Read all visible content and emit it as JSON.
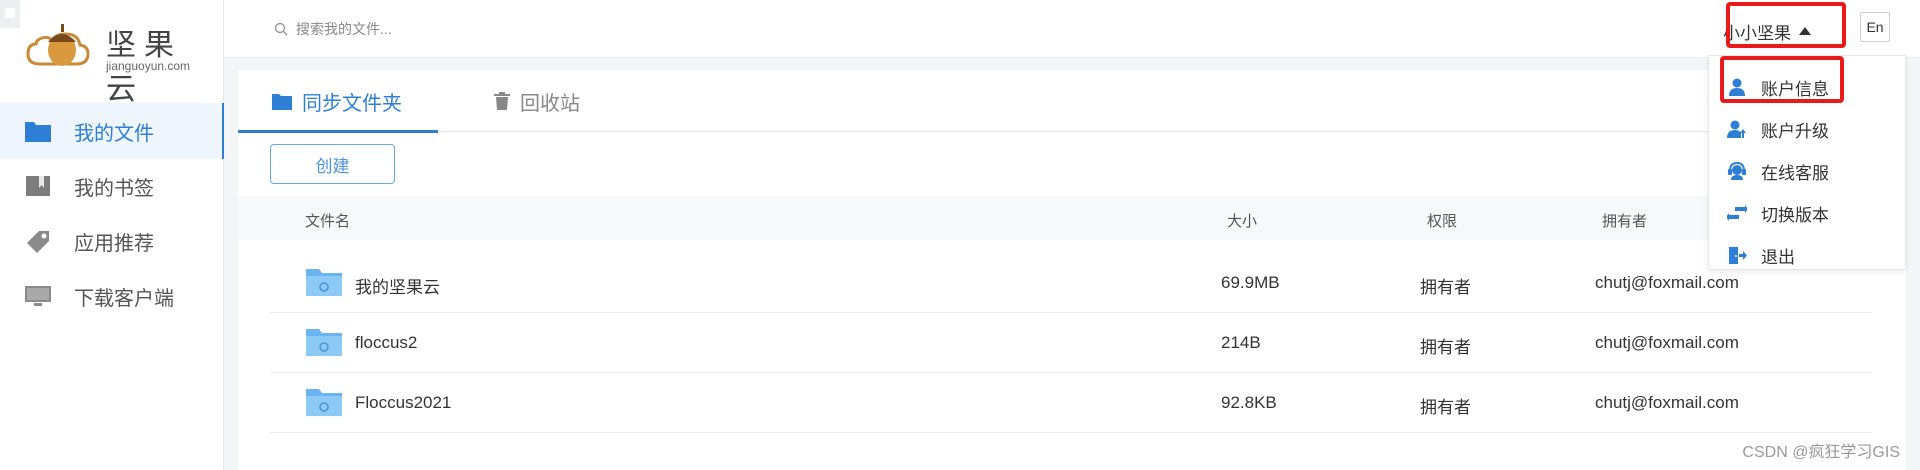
{
  "logo": {
    "text": "坚果云",
    "sub": "jianguoyun.com",
    "icon": "acorn-logo-icon"
  },
  "sidebar": {
    "items": [
      {
        "label": "我的文件",
        "icon": "folder-icon",
        "active": true
      },
      {
        "label": "我的书签",
        "icon": "bookmark-book-icon",
        "active": false
      },
      {
        "label": "应用推荐",
        "icon": "tag-icon",
        "active": false
      },
      {
        "label": "下载客户端",
        "icon": "monitor-icon",
        "active": false
      }
    ]
  },
  "header": {
    "search_placeholder": "搜索我的文件...",
    "user_name": "小小坚果",
    "lang_label": "En"
  },
  "tabs": [
    {
      "label": "同步文件夹",
      "icon": "folder-icon",
      "active": true
    },
    {
      "label": "回收站",
      "icon": "trash-icon",
      "active": false
    }
  ],
  "toolbar": {
    "create_label": "创建"
  },
  "table": {
    "columns": {
      "name": "文件名",
      "size": "大小",
      "permission": "权限",
      "owner": "拥有者"
    },
    "rows": [
      {
        "name": "我的坚果云",
        "size": "69.9MB",
        "permission": "拥有者",
        "owner": "chutj@foxmail.com"
      },
      {
        "name": "floccus2",
        "size": "214B",
        "permission": "拥有者",
        "owner": "chutj@foxmail.com"
      },
      {
        "name": "Floccus2021",
        "size": "92.8KB",
        "permission": "拥有者",
        "owner": "chutj@foxmail.com"
      }
    ]
  },
  "user_menu": {
    "items": [
      {
        "label": "账户信息",
        "icon": "user-icon"
      },
      {
        "label": "账户升级",
        "icon": "user-upgrade-icon"
      },
      {
        "label": "在线客服",
        "icon": "headset-icon"
      },
      {
        "label": "切换版本",
        "icon": "switch-arrows-icon"
      },
      {
        "label": "退出",
        "icon": "logout-icon"
      }
    ]
  },
  "watermark": "CSDN @疯狂学习GIS",
  "colors": {
    "accent": "#2d7fd6",
    "highlight": "#e81a1a",
    "folder": "#6ab5ef"
  }
}
